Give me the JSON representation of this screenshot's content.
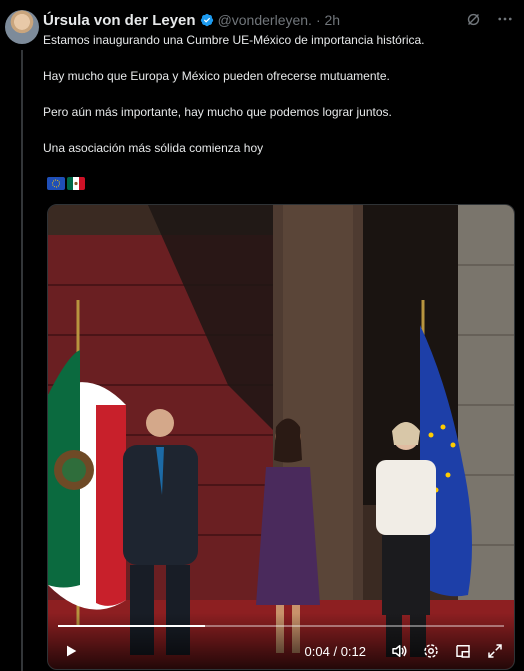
{
  "post": {
    "author_name": "Úrsula von der Leyen",
    "handle": "@vonderleyen.",
    "time": "· 2h",
    "text_lines": [
      "Estamos inaugurando una Cumbre UE-México de importancia histórica.",
      "Hay mucho que Europa y México pueden ofrecerse mutuamente.",
      "Pero aún más importante, hay mucho que podemos lograr juntos.",
      "Una asociación más sólida comienza hoy"
    ]
  },
  "video": {
    "current_time": "0:04",
    "separator": "/",
    "duration": "0:12",
    "progress": 0.33
  },
  "icons": {
    "grok": "grok-icon",
    "more": "more-icon",
    "verified": "verified-badge-icon",
    "play": "play-icon",
    "volume": "volume-icon",
    "settings": "settings-gear-icon",
    "pip": "picture-in-picture-icon",
    "fullscreen": "fullscreen-icon"
  },
  "colors": {
    "background": "#000000",
    "text": "#e7e9ea",
    "muted": "#71767b",
    "verified": "#1d9bf0"
  }
}
